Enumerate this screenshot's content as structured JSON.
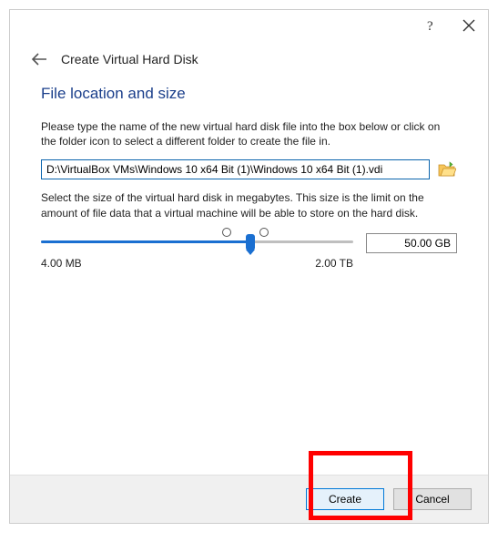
{
  "titlebar": {
    "help": "?",
    "close": "✕"
  },
  "header": {
    "title": "Create Virtual Hard Disk"
  },
  "section": {
    "title": "File location and size",
    "path_instruction": "Please type the name of the new virtual hard disk file into the box below or click on the folder icon to select a different folder to create the file in.",
    "path_value": "D:\\VirtualBox VMs\\Windows 10 x64 Bit (1)\\Windows 10 x64 Bit (1).vdi",
    "size_instruction": "Select the size of the virtual hard disk in megabytes. This size is the limit on the amount of file data that a virtual machine will be able to store on the hard disk."
  },
  "slider": {
    "min_label": "4.00 MB",
    "max_label": "2.00 TB",
    "size_display": "50.00 GB",
    "percent": 67
  },
  "footer": {
    "create": "Create",
    "cancel": "Cancel"
  }
}
